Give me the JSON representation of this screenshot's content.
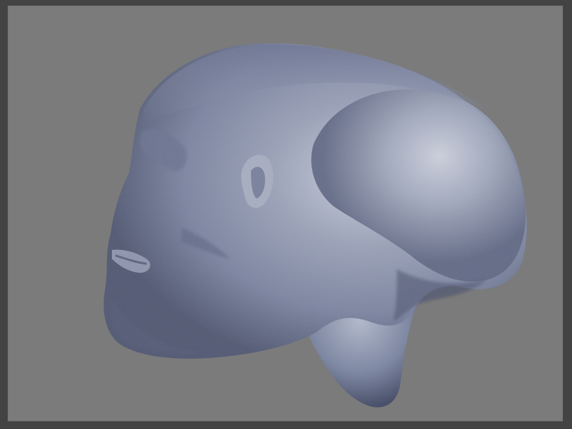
{
  "app": {
    "title": ""
  },
  "viewport": {
    "background_color": "#7b7b7b",
    "frame_color": "#434343",
    "model": {
      "icon": "sculpt-head-model",
      "base_color": "#8a93aa",
      "shadow_color": "#4e5570",
      "highlight_color": "#c9cedc"
    }
  }
}
